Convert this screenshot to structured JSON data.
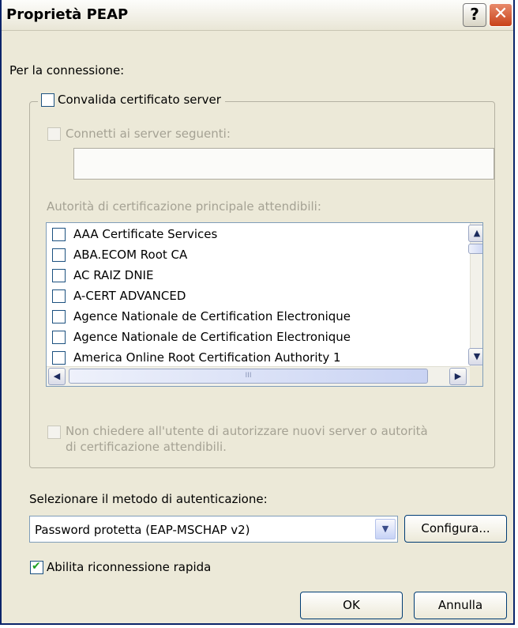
{
  "window": {
    "title": "Proprietà PEAP",
    "help_glyph": "?",
    "close_glyph": "✕"
  },
  "connection_label": "Per la connessione:",
  "validate_cert": {
    "label": "Convalida certificato server",
    "checked": false
  },
  "connect_servers": {
    "label": "Connetti ai server seguenti:",
    "value": "",
    "enabled": false
  },
  "trusted_ca": {
    "label": "Autorità di certificazione principale attendibili:",
    "items": [
      "AAA Certificate Services",
      "ABA.ECOM Root CA",
      "AC RAIZ DNIE",
      "A-CERT ADVANCED",
      "Agence Nationale de Certification Electronique",
      "Agence Nationale de Certification Electronique",
      "America Online Root Certification Authority 1"
    ],
    "hscroll_thumb_glyph": "III"
  },
  "no_prompt": {
    "line1": "Non chiedere all'utente di autorizzare nuovi server o autorità",
    "line2": "di certificazione attendibili.",
    "enabled": false
  },
  "auth_method": {
    "label": "Selezionare il metodo di autenticazione:",
    "selected": "Password protetta (EAP-MSCHAP v2)",
    "configure_label": "Configura..."
  },
  "fast_reconnect": {
    "label": "Abilita riconnessione rapida",
    "checked": true
  },
  "buttons": {
    "ok": "OK",
    "cancel": "Annulla"
  },
  "icons": {
    "help": "help-icon",
    "close": "close-icon",
    "check": "checkmark-icon",
    "scroll_up": "arrow-up-icon",
    "scroll_down": "arrow-down-icon",
    "scroll_left": "arrow-left-icon",
    "scroll_right": "arrow-right-icon",
    "dropdown": "chevron-down-icon"
  },
  "colors": {
    "dialog_bg": "#ece9d8",
    "title_border": "#0a246a",
    "close_red": "#c8421a",
    "disabled_text": "#a5a294",
    "check_green": "#21a121"
  }
}
